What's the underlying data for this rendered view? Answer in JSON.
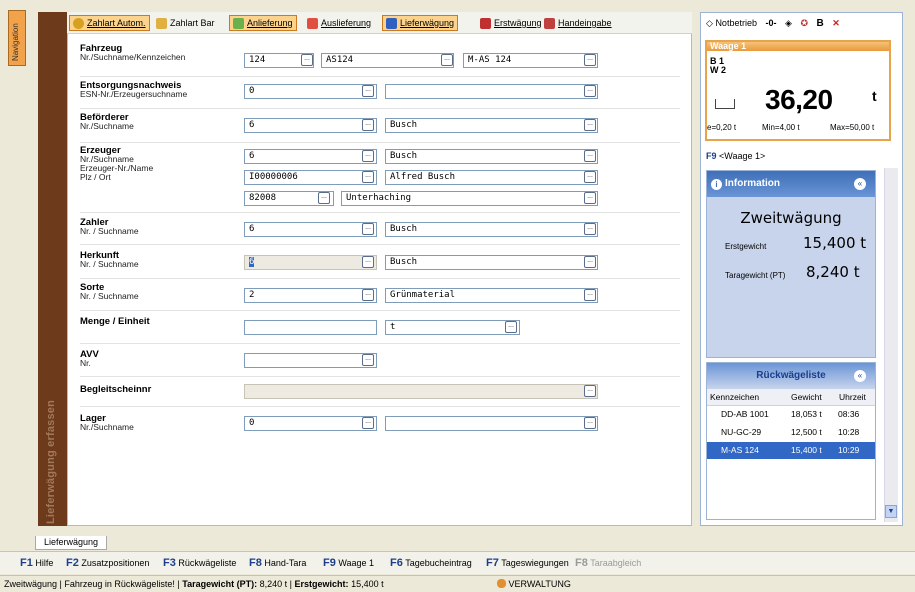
{
  "nav": {
    "label": "Navigation"
  },
  "side_title": "Lieferwägung erfassen",
  "toolbar": [
    {
      "label": "Zahlart Autom.",
      "selected": true,
      "color": "#d6a020"
    },
    {
      "label": "Zahlart Bar",
      "selected": false,
      "color": "#e0b040"
    },
    {
      "label": "Anlieferung",
      "selected": true,
      "color": "#6ab04c"
    },
    {
      "label": "Auslieferung",
      "selected": false,
      "color": "#e05040"
    },
    {
      "label": "Lieferwägung",
      "selected": true,
      "color": "#3060c0"
    },
    {
      "label": "Erstwägung",
      "selected": false,
      "color": "#c03030"
    },
    {
      "label": "Handeingabe",
      "selected": false,
      "color": "#c04040"
    }
  ],
  "form": {
    "fahrzeug": {
      "title": "Fahrzeug",
      "sub": "Nr./Suchname/Kennzeichen",
      "nr": "124",
      "suchname": "AS124",
      "kennzeichen": "M-AS 124"
    },
    "entsorgung": {
      "title": "Entsorgungsnachweis",
      "sub": "ESN-Nr./Erzeugersuchname",
      "nr": "0",
      "name": ""
    },
    "befoerderer": {
      "title": "Beförderer",
      "sub": "Nr./Suchname",
      "nr": "6",
      "name": "Busch"
    },
    "erzeuger": {
      "title": "Erzeuger",
      "sub1": "Nr./Suchname",
      "sub2": "Erzeuger-Nr./Name",
      "sub3": "Plz / Ort",
      "nr": "6",
      "name": "Busch",
      "erz_nr": "I00000006",
      "erz_name": "Alfred Busch",
      "plz": "82008",
      "ort": "Unterhaching"
    },
    "zahler": {
      "title": "Zahler",
      "sub": "Nr. / Suchname",
      "nr": "6",
      "name": "Busch"
    },
    "herkunft": {
      "title": "Herkunft",
      "sub": "Nr. / Suchname",
      "nr": "6",
      "name": "Busch"
    },
    "sorte": {
      "title": "Sorte",
      "sub": "Nr. / Suchname",
      "nr": "2",
      "name": "Grünmaterial"
    },
    "menge": {
      "title": "Menge / Einheit",
      "menge": "",
      "einheit": "t"
    },
    "avv": {
      "title": "AVV",
      "sub": "Nr.",
      "nr": ""
    },
    "begleit": {
      "title": "Begleitscheinnr",
      "value": ""
    },
    "lager": {
      "title": "Lager",
      "sub": "Nr./Suchname",
      "nr": "0",
      "name": ""
    }
  },
  "bottom_tab": "Lieferwägung",
  "fkeys": [
    {
      "key": "F1",
      "label": "Hilfe",
      "disabled": false
    },
    {
      "key": "F2",
      "label": "Zusatzpositionen",
      "disabled": false
    },
    {
      "key": "F3",
      "label": "Rückwägeliste",
      "disabled": false
    },
    {
      "key": "F8",
      "label": "Hand-Tara",
      "disabled": false
    },
    {
      "key": "F9",
      "label": "Waage 1",
      "disabled": false
    },
    {
      "key": "F6",
      "label": "Tagebucheintrag",
      "disabled": false
    },
    {
      "key": "F7",
      "label": "Tageswiegungen",
      "disabled": false
    },
    {
      "key": "F8",
      "label": "Taraabgleich",
      "disabled": true
    }
  ],
  "status": {
    "msg": "Zweitwägung | Fahrzeug in Rückwägeliste! |",
    "tara_label": "Taragewicht (PT):",
    "tara_value": "8,240 t |",
    "erst_label": "Erstgewicht:",
    "erst_value": "15,400 t",
    "user": "VERWALTUNG"
  },
  "right": {
    "top_buttons": {
      "notbetrieb": "Notbetrieb",
      "b": "B"
    },
    "scale": {
      "title": "Waage 1",
      "b": "B 1",
      "w": "W 2",
      "weight": "36,20",
      "unit": "t",
      "e": "e=0,20 t",
      "min": "Min=4,00 t",
      "max": "Max=50,00 t"
    },
    "scale_key": "F9",
    "scale_select": "<Waage 1>",
    "info": {
      "title": "Information",
      "mode": "Zweitwägung",
      "erst_label": "Erstgewicht",
      "erst_value": "15,400 t",
      "tara_label": "Taragewicht (PT)",
      "tara_value": "8,240 t"
    },
    "rueck": {
      "title": "Rückwägeliste",
      "headers": [
        "Kennzeichen",
        "Gewicht",
        "Uhrzeit"
      ],
      "rows": [
        {
          "kennzeichen": "DD-AB 1001",
          "gewicht": "18,053 t",
          "uhrzeit": "08:36",
          "selected": false
        },
        {
          "kennzeichen": "NU-GC-29",
          "gewicht": "12,500 t",
          "uhrzeit": "10:28",
          "selected": false
        },
        {
          "kennzeichen": "M-AS 124",
          "gewicht": "15,400 t",
          "uhrzeit": "10:29",
          "selected": true
        }
      ]
    }
  }
}
